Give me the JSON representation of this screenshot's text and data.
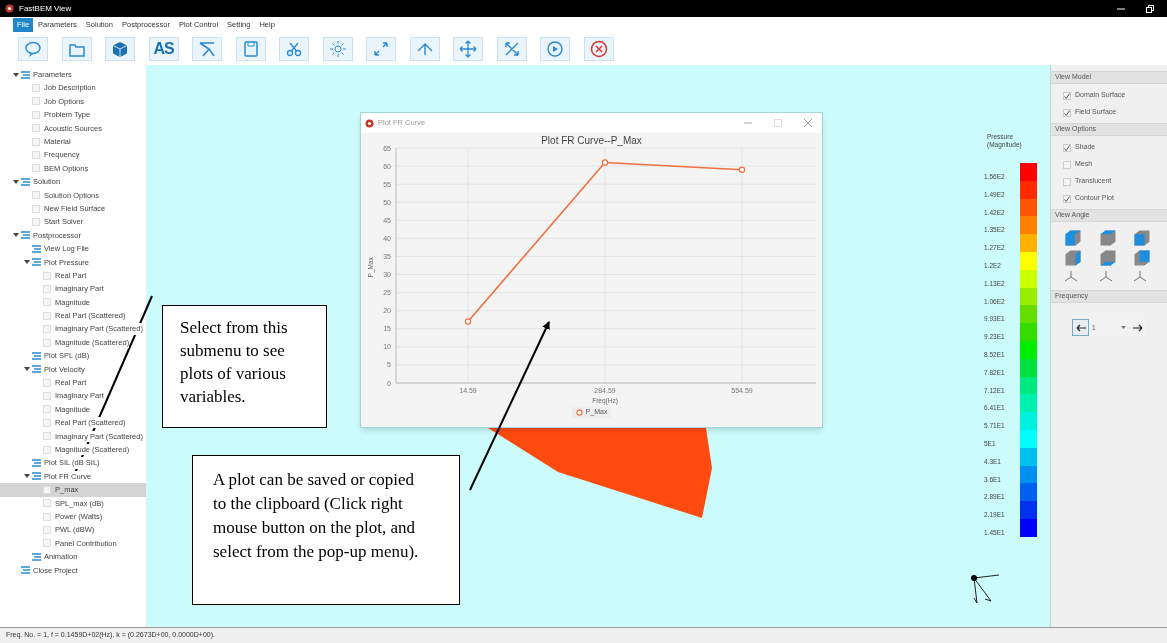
{
  "window": {
    "title": "FastBEM View"
  },
  "menu": [
    {
      "label": "File",
      "selected": true
    },
    {
      "label": "Parameters",
      "selected": false
    },
    {
      "label": "Solution",
      "selected": false
    },
    {
      "label": "Postprocessor",
      "selected": false
    },
    {
      "label": "Plot Control",
      "selected": false
    },
    {
      "label": "Setting",
      "selected": false
    },
    {
      "label": "Help",
      "selected": false
    }
  ],
  "toolbar": {
    "text_button": "AS"
  },
  "tree": [
    {
      "label": "Parameters",
      "kind": "group",
      "expanded": true,
      "selected": false,
      "children": [
        {
          "label": "Job Description",
          "kind": "leaf",
          "selected": false
        },
        {
          "label": "Job Options",
          "kind": "leaf",
          "selected": false
        },
        {
          "label": "Problem Type",
          "kind": "leaf",
          "selected": false
        },
        {
          "label": "Acoustic Sources",
          "kind": "leaf",
          "selected": false
        },
        {
          "label": "Material",
          "kind": "leaf",
          "selected": false
        },
        {
          "label": "Frequency",
          "kind": "leaf",
          "selected": false
        },
        {
          "label": "BEM Options",
          "kind": "leaf",
          "selected": false
        }
      ]
    },
    {
      "label": "Solution",
      "kind": "group",
      "expanded": true,
      "selected": false,
      "children": [
        {
          "label": "Solution Options",
          "kind": "leaf",
          "selected": false
        },
        {
          "label": "New Field Surface",
          "kind": "leaf",
          "selected": false
        },
        {
          "label": "Start Solver",
          "kind": "leaf",
          "selected": false
        }
      ]
    },
    {
      "label": "Postprocessor",
      "kind": "group",
      "expanded": true,
      "selected": false,
      "children": [
        {
          "label": "View Log File",
          "kind": "group",
          "expanded": false,
          "selected": false
        },
        {
          "label": "Plot Pressure",
          "kind": "group",
          "expanded": true,
          "selected": false,
          "children": [
            {
              "label": "Real Part",
              "kind": "leaf",
              "selected": false
            },
            {
              "label": "Imaginary Part",
              "kind": "leaf",
              "selected": false
            },
            {
              "label": "Magnitude",
              "kind": "leaf",
              "selected": false
            },
            {
              "label": "Real Part (Scattered)",
              "kind": "leaf",
              "selected": false
            },
            {
              "label": "Imaginary Part (Scattered)",
              "kind": "leaf",
              "selected": false
            },
            {
              "label": "Magnitude (Scattered)",
              "kind": "leaf",
              "selected": false
            }
          ]
        },
        {
          "label": "Plot SPL (dB)",
          "kind": "group",
          "expanded": false,
          "selected": false
        },
        {
          "label": "Plot Velocity",
          "kind": "group",
          "expanded": true,
          "selected": false,
          "children": [
            {
              "label": "Real Part",
              "kind": "leaf",
              "selected": false
            },
            {
              "label": "Imaginary Part",
              "kind": "leaf",
              "selected": false
            },
            {
              "label": "Magnitude",
              "kind": "leaf",
              "selected": false
            },
            {
              "label": "Real Part (Scattered)",
              "kind": "leaf",
              "selected": false
            },
            {
              "label": "Imaginary Part (Scattered)",
              "kind": "leaf",
              "selected": false
            },
            {
              "label": "Magnitude (Scattered)",
              "kind": "leaf",
              "selected": false
            }
          ]
        },
        {
          "label": "Plot SIL (dB SIL)",
          "kind": "group",
          "expanded": false,
          "selected": false
        },
        {
          "label": "Plot FR Curve",
          "kind": "group",
          "expanded": true,
          "selected": false,
          "children": [
            {
              "label": "P_max",
              "kind": "leaf",
              "selected": true
            },
            {
              "label": "SPL_max (dB)",
              "kind": "leaf",
              "selected": false
            },
            {
              "label": "Power (Watts)",
              "kind": "leaf",
              "selected": false
            },
            {
              "label": "PWL (dBW)",
              "kind": "leaf",
              "selected": false
            },
            {
              "label": "Panel Contribution",
              "kind": "leaf",
              "selected": false
            }
          ]
        },
        {
          "label": "Animation",
          "kind": "group",
          "expanded": false,
          "selected": false
        }
      ]
    },
    {
      "label": "Close Project",
      "kind": "group",
      "expanded": false,
      "selected": false
    }
  ],
  "plot_window": {
    "title": "Plot FR Curve",
    "chart_data": {
      "type": "line",
      "title": "Plot FR Curve--P_Max",
      "xlabel": "Freq(Hz)",
      "ylabel": "P_Max",
      "categories": [
        "14.59",
        "284.59",
        "554.59"
      ],
      "series": [
        {
          "name": "P_Max",
          "color": "#f07040",
          "values": [
            17,
            61,
            59
          ]
        }
      ],
      "grid": true,
      "marker": "circle",
      "ylim": [
        0,
        65
      ],
      "yticks": [
        0,
        5,
        10,
        15,
        20,
        25,
        30,
        35,
        40,
        45,
        50,
        55,
        60,
        65
      ]
    }
  },
  "color_legend": {
    "title": "Pressure\n(Magnitude)",
    "levels": [
      {
        "label": "1.56E2",
        "color": "#ff0000"
      },
      {
        "label": "1.49E2",
        "color": "#ff2a00"
      },
      {
        "label": "1.42E2",
        "color": "#ff5500"
      },
      {
        "label": "1.35E2",
        "color": "#ff8000"
      },
      {
        "label": "1.27E2",
        "color": "#ffb000"
      },
      {
        "label": "1.2E2",
        "color": "#ffff00"
      },
      {
        "label": "1.13E2",
        "color": "#ccff00"
      },
      {
        "label": "1.06E2",
        "color": "#99ee00"
      },
      {
        "label": "9.93E1",
        "color": "#66dd00"
      },
      {
        "label": "9.23E1",
        "color": "#33dd00"
      },
      {
        "label": "8.52E1",
        "color": "#00ee00"
      },
      {
        "label": "7.82E1",
        "color": "#00e040"
      },
      {
        "label": "7.12E1",
        "color": "#00e880"
      },
      {
        "label": "6.41E1",
        "color": "#00f0b0"
      },
      {
        "label": "5.71E1",
        "color": "#00f0e0"
      },
      {
        "label": "5E1",
        "color": "#00ffff"
      },
      {
        "label": "4.3E1",
        "color": "#00c0f0"
      },
      {
        "label": "3.6E1",
        "color": "#0090f0"
      },
      {
        "label": "2.89E1",
        "color": "#0060f0"
      },
      {
        "label": "2.19E1",
        "color": "#0030f0"
      },
      {
        "label": "1.45E1",
        "color": "#0000ff"
      }
    ]
  },
  "right_panel": {
    "view_model": {
      "title": "View Model",
      "options": [
        {
          "label": "Domain Surface",
          "checked": true
        },
        {
          "label": "Field Surface",
          "checked": true
        }
      ]
    },
    "view_options": {
      "title": "View Options",
      "options": [
        {
          "label": "Shade",
          "checked": true
        },
        {
          "label": "Mesh",
          "checked": false
        },
        {
          "label": "Translucent",
          "checked": false
        },
        {
          "label": "Contour Plot",
          "checked": true
        }
      ]
    },
    "view_angle": {
      "title": "View Angle"
    },
    "frequency": {
      "title": "Frequency",
      "value": "1"
    }
  },
  "callouts": [
    {
      "text": "Select from this submenu to see plots of various variables."
    },
    {
      "text": "A plot can be saved or copied to the clipboard (Click right mouse button on the plot, and select from the pop-up menu)."
    }
  ],
  "status_bar": "Freq. No. =  1,  f = 0.1459D+02(Hz),  k = (0.2673D+00, 0.0000D+00)."
}
